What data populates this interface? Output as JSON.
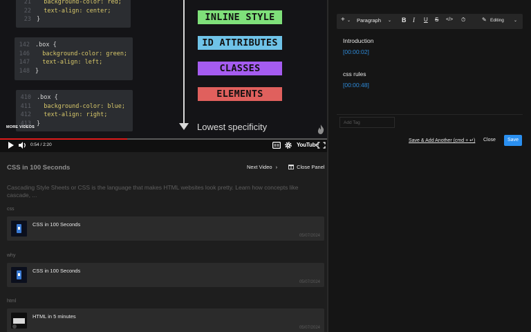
{
  "video": {
    "code_cards": [
      {
        "lines": [
          {
            "num": "21",
            "text": "  background-color: red;"
          },
          {
            "num": "22",
            "text": "  text-align: center;"
          },
          {
            "num": "23",
            "text": "}"
          }
        ]
      },
      {
        "lines": [
          {
            "num": "142",
            "text": ".box {"
          },
          {
            "num": "146",
            "text": "  background-color: green;"
          },
          {
            "num": "147",
            "text": "  text-align: left;"
          },
          {
            "num": "148",
            "text": "}"
          }
        ]
      },
      {
        "lines": [
          {
            "num": "410",
            "text": ".box {"
          },
          {
            "num": "411",
            "text": "  background-color: blue;"
          },
          {
            "num": "412",
            "text": "  text-align: right;"
          },
          {
            "num": "413",
            "text": "}"
          }
        ]
      }
    ],
    "specificity": [
      {
        "label": "INLINE STYLE",
        "color": "#7fe07a"
      },
      {
        "label": "ID ATTRIBUTES",
        "color": "#6fc3e8"
      },
      {
        "label": "CLASSES",
        "color": "#a55cf0"
      },
      {
        "label": "ELEMENTS",
        "color": "#e0605d"
      }
    ],
    "lowest_label": "Lowest specificity",
    "more_videos": "MORE VIDEOS",
    "time": "0:54 / 2:20",
    "progress": 0.39,
    "brand": "YouTube"
  },
  "panel": {
    "title": "CSS in 100 Seconds",
    "next_label": "Next Video",
    "close_label": "Close Panel",
    "description": "Cascading Style Sheets or CSS is the language that makes HTML websites look pretty. Learn how concepts like cascade, ...",
    "groups": [
      {
        "tag": "css",
        "video_title": "CSS in 100 Seconds",
        "date": "05/07/2024"
      },
      {
        "tag": "why",
        "video_title": "CSS in 100 Seconds",
        "date": "05/07/2024"
      },
      {
        "tag": "html",
        "video_title": "HTML in 5 minutes",
        "date": "05/07/2024"
      }
    ]
  },
  "editor": {
    "paragraph_label": "Paragraph",
    "editing_label": "Editing",
    "notes": [
      {
        "heading": "Introduction",
        "timestamp": "[00:00:02]"
      },
      {
        "heading": "css rules",
        "timestamp": "[00:00:48]"
      }
    ],
    "add_tag_placeholder": "Add Tag",
    "save_add_label": "Save & Add Another (cmd + ↵)",
    "close_label": "Close",
    "save_label": "Save"
  },
  "colors": {
    "accent": "#2a8ff0",
    "link": "#2e8ad8",
    "progress": "#e01b1b"
  }
}
